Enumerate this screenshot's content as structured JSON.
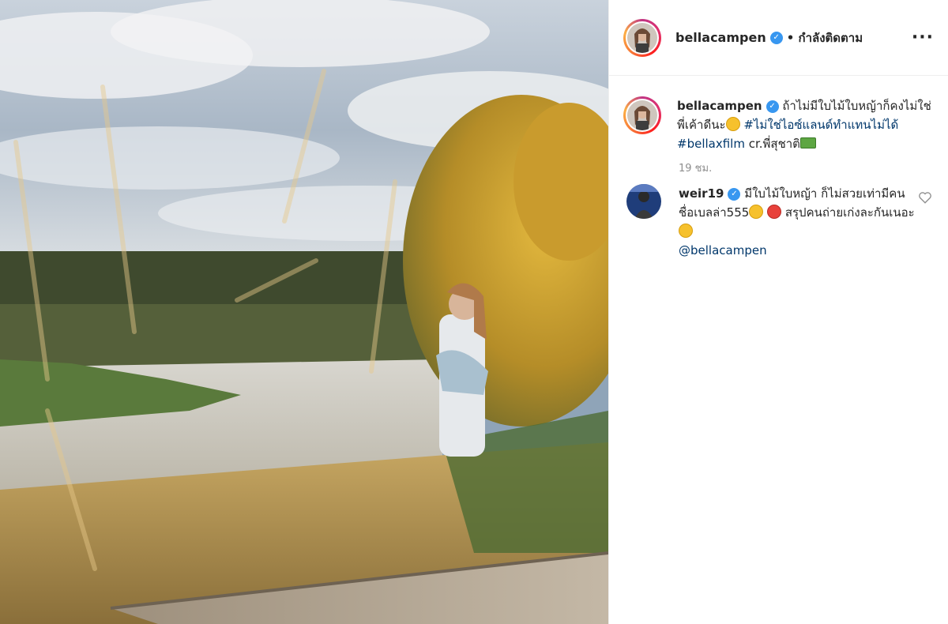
{
  "post": {
    "author": "bellacampen",
    "follow_status": "• กำลังติดตาม",
    "more_icon": "more-horizontal-icon"
  },
  "caption": {
    "author": "bellacampen",
    "text_1": " ถ้าไม่มีใบไม้ใบหญ้าก็คงไม่ใช่พี่เค้าดีนะ",
    "hashtag_1": "#ไม่ใช่ไอซ์แลนด์ทำแทนไม่ได้",
    "hashtag_2": "#bellaxfilm",
    "text_2": " cr.พี่สุชาติ",
    "timestamp": "19 ชม."
  },
  "comment": {
    "author": "weir19",
    "text_1": " มีใบไม้ใบหญ้า ก็ไม่สวยเท่ามีคนชื่อเบลล่า555",
    "text_2": " สรุปคนถ่ายเก่งละกันเนอะ",
    "mention": "@bellacampen",
    "like_icon": "heart-outline-icon"
  },
  "colors": {
    "link": "#00376b",
    "verified": "#3897f0",
    "muted": "#8e8e8e"
  }
}
